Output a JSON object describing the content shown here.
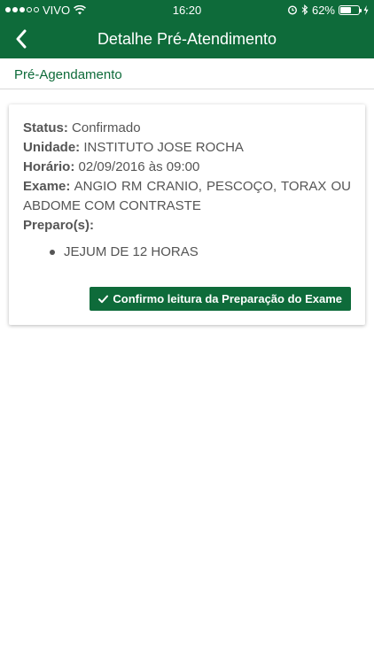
{
  "status_bar": {
    "carrier": "VIVO",
    "time": "16:20",
    "battery_percent": "62%",
    "battery_level": 0.62
  },
  "navbar": {
    "title": "Detalhe Pré-Atendimento",
    "back_icon": "chevron-left-icon"
  },
  "section": {
    "title": "Pré-Agendamento"
  },
  "details": {
    "status_label": "Status:",
    "status_value": "Confirmado",
    "unidade_label": "Unidade:",
    "unidade_value": "INSTITUTO JOSE ROCHA",
    "horario_label": "Horário:",
    "horario_value": "02/09/2016 às 09:00",
    "exame_label": "Exame:",
    "exame_value": "ANGIO RM CRANIO, PESCOÇO, TORAX OU ABDOME COM CONTRASTE",
    "preparo_label": "Preparo(s):",
    "preparos": [
      "JEJUM DE 12 HORAS"
    ]
  },
  "actions": {
    "confirm_label": "Confirmo leitura da Preparação do Exame",
    "confirm_icon": "check-icon"
  },
  "colors": {
    "brand": "#0e6b3a",
    "text": "#555555"
  }
}
